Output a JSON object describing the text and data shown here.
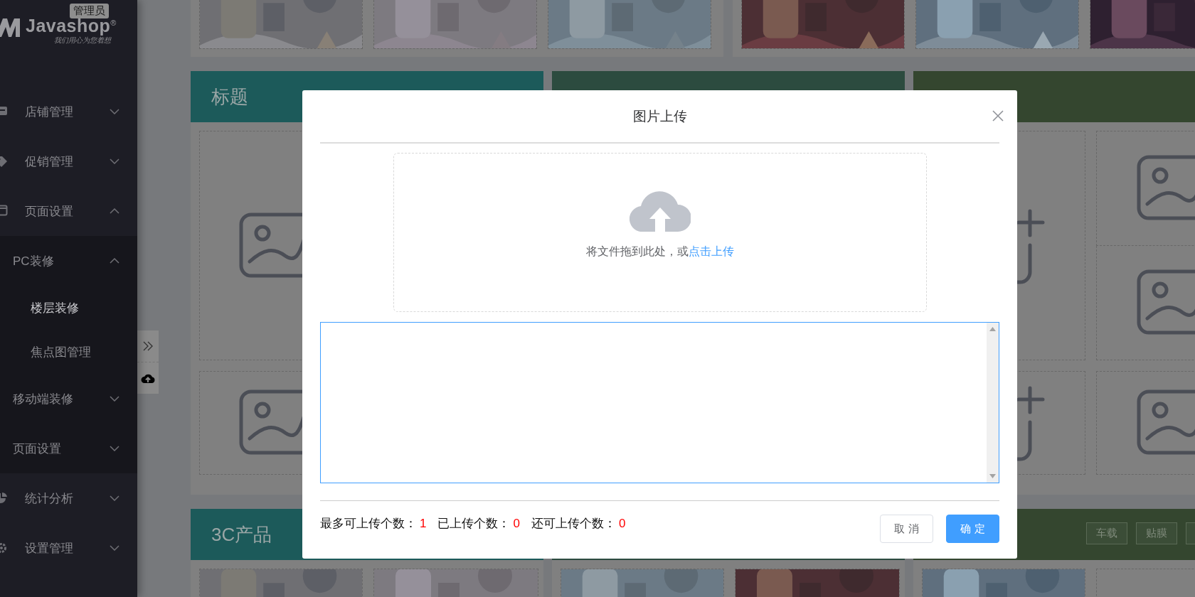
{
  "sidebar": {
    "logo": {
      "name": "Javashop$^{®}$",
      "badge": "管理员",
      "slogan": "我们用心为您着想"
    },
    "items": [
      {
        "label": "店铺管理",
        "expanded": false
      },
      {
        "label": "促销管理",
        "expanded": false
      },
      {
        "label": "页面设置",
        "expanded": true,
        "children": [
          {
            "label": "PC装修",
            "expanded": true,
            "children": [
              {
                "label": "楼层装修",
                "selected": true
              },
              {
                "label": "焦点图管理",
                "selected": false
              }
            ]
          },
          {
            "label": "移动端装修",
            "expanded": false
          },
          {
            "label": "页面设置",
            "expanded": false
          }
        ]
      },
      {
        "label": "统计分析",
        "expanded": false
      },
      {
        "label": "设置管理",
        "expanded": false
      }
    ]
  },
  "floors": [
    {
      "title": "标题"
    },
    {
      "title": "3C产品",
      "tags": [
        "车载",
        "贴膜"
      ]
    }
  ],
  "modal": {
    "title": "图片上传",
    "upload": {
      "hint": "将文件拖到此处，或",
      "link": "点击上传"
    },
    "stats": [
      {
        "label": "最多可上传个数：",
        "value": "1"
      },
      {
        "label": "已上传个数：",
        "value": "0"
      },
      {
        "label": "还可上传个数：",
        "value": "0"
      }
    ],
    "buttons": [
      {
        "label": "取 消",
        "kind": "default"
      },
      {
        "label": "确 定",
        "kind": "primary"
      }
    ]
  }
}
